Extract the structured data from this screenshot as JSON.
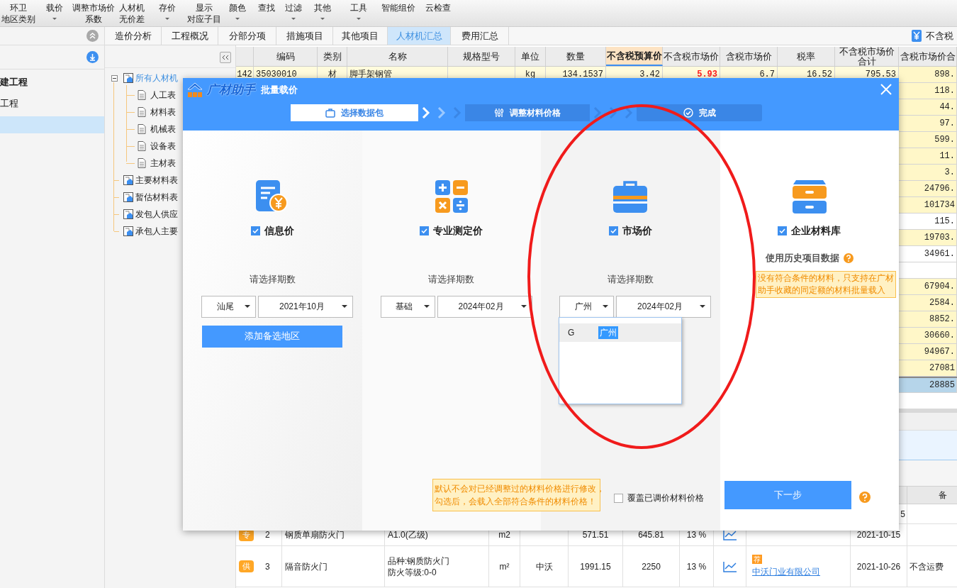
{
  "toolbar": [
    {
      "line1": "环卫",
      "line2": "地区类别",
      "dropdown": false
    },
    {
      "line1": "载价",
      "dropdown": true
    },
    {
      "line1": "调整市场价",
      "line2": "系数",
      "dropdown": false
    },
    {
      "line1": "人材机",
      "line2": "无价差",
      "dropdown": false
    },
    {
      "line1": "存价",
      "dropdown": true
    },
    {
      "line1": "显示",
      "line2": "对应子目",
      "dropdown": false
    },
    {
      "line1": "颜色",
      "dropdown": true
    },
    {
      "line1": "查找",
      "dropdown": false
    },
    {
      "line1": "过滤",
      "dropdown": true
    },
    {
      "line1": "其他",
      "dropdown": true
    },
    {
      "line1": "工具",
      "dropdown": true
    },
    {
      "line1": "智能组价",
      "dropdown": false
    },
    {
      "line1": "云检查",
      "dropdown": false
    }
  ],
  "left_panel": {
    "items": [
      {
        "label": "建工程",
        "selected": false
      },
      {
        "label": "工程",
        "selected": false
      },
      {
        "selected": true
      }
    ]
  },
  "tabs": [
    {
      "label": "造价分析",
      "selected": false
    },
    {
      "label": "工程概况",
      "selected": false
    },
    {
      "label": "分部分项",
      "selected": false
    },
    {
      "label": "措施项目",
      "selected": false
    },
    {
      "label": "其他项目",
      "selected": false
    },
    {
      "label": "人材机汇总",
      "selected": true
    },
    {
      "label": "费用汇总",
      "selected": false
    }
  ],
  "tax_toggle": {
    "label": "不含税"
  },
  "tree": {
    "items": [
      {
        "label": "所有人材机",
        "selected": true,
        "expanded": true,
        "children": [
          {
            "label": "人工表",
            "selected": false
          },
          {
            "label": "材料表",
            "selected": false
          },
          {
            "label": "机械表",
            "selected": false
          },
          {
            "label": "设备表",
            "selected": false
          },
          {
            "label": "主材表",
            "selected": false
          }
        ]
      },
      {
        "label": "主要材料表",
        "selected": false
      },
      {
        "label": "暂估材料表",
        "selected": false
      },
      {
        "label": "发包人供应",
        "selected": false
      },
      {
        "label": "承包人主要",
        "selected": false
      }
    ]
  },
  "table": {
    "columns": [
      {},
      {
        "label": "编码",
        "selected": false
      },
      {
        "label": "类别",
        "selected": false
      },
      {
        "label": "名称",
        "selected": false
      },
      {
        "label": "规格型号",
        "selected": false
      },
      {
        "label": "单位",
        "selected": false
      },
      {
        "label": "数量",
        "selected": false
      },
      {
        "label": "不含税预算价",
        "selected": true
      },
      {
        "label": "不含税市场价",
        "selected": false
      },
      {
        "label": "含税市场价",
        "selected": false
      },
      {
        "label": "税率",
        "selected": false
      },
      {
        "label": "不含税市场价合计",
        "selected": false
      },
      {
        "label": "含税市场价合",
        "selected": false
      }
    ],
    "rows": [
      {
        "kind": "full",
        "highlighted": true,
        "price_adjusted": true,
        "cells": [
          "142",
          "35030010",
          "材",
          "脚手架钢管",
          "",
          "kg",
          "134.1537",
          "3.42",
          "5.93",
          "6.7",
          "16.52",
          "795.53",
          "898."
        ]
      },
      {
        "kind": "partial",
        "highlighted": true,
        "last": "118."
      },
      {
        "kind": "partial",
        "highlighted": true,
        "last": "44."
      },
      {
        "kind": "partial",
        "highlighted": true,
        "last": "97."
      },
      {
        "kind": "partial",
        "highlighted": true,
        "last": "599."
      },
      {
        "kind": "partial",
        "highlighted": true,
        "last": "11."
      },
      {
        "kind": "partial",
        "highlighted": true,
        "last": "3."
      },
      {
        "kind": "partial",
        "highlighted": true,
        "last": "24796."
      },
      {
        "kind": "partial",
        "highlighted": true,
        "last": "101734"
      },
      {
        "kind": "partial",
        "highlighted": false,
        "last": "115."
      },
      {
        "kind": "partial",
        "highlighted": true,
        "last": "19703."
      },
      {
        "kind": "partial",
        "highlighted": false,
        "last": "34961."
      },
      {
        "kind": "partial",
        "highlighted": false
      },
      {
        "kind": "partial",
        "highlighted": true,
        "last": "67904."
      },
      {
        "kind": "partial",
        "highlighted": true,
        "last": "2584."
      },
      {
        "kind": "partial",
        "highlighted": true,
        "last": "8852."
      },
      {
        "kind": "partial",
        "highlighted": true,
        "last": "30660."
      },
      {
        "kind": "partial",
        "highlighted": true,
        "last": "94967."
      },
      {
        "kind": "partial",
        "highlighted": true,
        "last": "27081"
      },
      {
        "kind": "total",
        "last": "28885"
      }
    ]
  },
  "lower_table": {
    "last_column": "备",
    "rows": [
      {
        "kind": "partial",
        "date": "5"
      },
      {
        "kind": "full",
        "badge": "专",
        "index": "2",
        "name": "钢质单扇防火门",
        "spec": [
          "A1.0(乙级)"
        ],
        "unit": "m2",
        "price": "571.51",
        "tax_price": "645.81",
        "tax_rate": "13 %",
        "date": "2021-10-15"
      },
      {
        "kind": "full",
        "badge": "供",
        "index": "3",
        "name": "隔音防火门",
        "spec": [
          "品种:钢质防火门",
          "防火等级:0-0"
        ],
        "unit": "m²",
        "brand": "中沃",
        "price": "1991.15",
        "tax_price": "2250",
        "tax_rate": "13 %",
        "recommended": "荐",
        "supplier": "中沃门业有限公司",
        "date": "2021-10-26",
        "remark": "不含运费"
      }
    ]
  },
  "dialog": {
    "logo_text": "广材助手",
    "title": "批量载价",
    "steps": [
      {
        "label": "选择数据包",
        "selected": true
      },
      {
        "label": "调整材料价格",
        "selected": false
      },
      {
        "label": "完成",
        "selected": false
      }
    ],
    "sources": [
      {
        "kind": "info",
        "label": "信息价",
        "checked": true,
        "period_label": "请选择期数",
        "region": "汕尾",
        "period": "2021年10月",
        "add_button": "添加备选地区"
      },
      {
        "kind": "measured",
        "label": "专业测定价",
        "checked": true,
        "period_label": "请选择期数",
        "region": "基础",
        "period": "2024年02月"
      },
      {
        "kind": "market",
        "label": "市场价",
        "checked": true,
        "period_label": "请选择期数",
        "region": "广州",
        "period": "2024年02月",
        "options": [
          {
            "letter": "G",
            "label": "广州",
            "selected": true
          }
        ]
      },
      {
        "kind": "enterprise",
        "label": "企业材料库",
        "checked": true,
        "history_label": "使用历史项目数据",
        "note": [
          "没有符合条件的材料，只支持在广材",
          "助手收藏的同定额的材料批量载入"
        ]
      }
    ],
    "tooltip": [
      "默认不会对已经调整过的材料价格进行修改，",
      "勾选后，会载入全部符合条件的材料价格！"
    ],
    "overwrite": {
      "label": "覆盖已调价材料价格",
      "checked": false
    },
    "next_button": "下一步"
  }
}
